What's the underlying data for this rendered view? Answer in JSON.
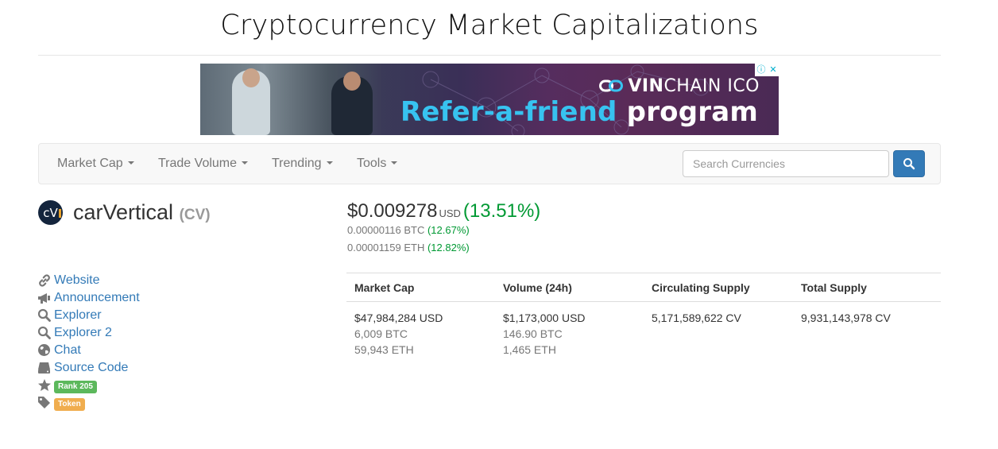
{
  "site": {
    "title": "Cryptocurrency Market Capitalizations"
  },
  "ad": {
    "brand_bold": "VIN",
    "brand_rest": "CHAIN ICO",
    "headline_part1": "Refer-a-friend",
    "headline_part2": "program",
    "choices_icons": [
      "info-icon",
      "close-icon"
    ]
  },
  "navbar": {
    "items": [
      {
        "label": "Market Cap"
      },
      {
        "label": "Trade Volume"
      },
      {
        "label": "Trending"
      },
      {
        "label": "Tools"
      }
    ],
    "search": {
      "placeholder": "Search Currencies",
      "button_icon": "search-icon"
    }
  },
  "coin": {
    "logo_text": "cV",
    "name": "carVertical",
    "symbol": "(CV)",
    "price": {
      "usd": "$0.009278",
      "usd_unit": "USD",
      "usd_change": "(13.51%)",
      "btc": "0.00000116 BTC",
      "btc_change": "(12.67%)",
      "eth": "0.00001159 ETH",
      "eth_change": "(12.82%)"
    }
  },
  "links": [
    {
      "label": "Website",
      "icon": "link-icon"
    },
    {
      "label": "Announcement",
      "icon": "bullhorn-icon"
    },
    {
      "label": "Explorer",
      "icon": "search-icon"
    },
    {
      "label": "Explorer 2",
      "icon": "search-icon"
    },
    {
      "label": "Chat",
      "icon": "globe-icon"
    },
    {
      "label": "Source Code",
      "icon": "hdd-icon"
    }
  ],
  "badges": {
    "rank": {
      "label": "Rank 205",
      "icon": "star-icon",
      "color": "#5cb85c"
    },
    "type": {
      "label": "Token",
      "icon": "tag-icon",
      "color": "#f0ad4e"
    }
  },
  "stats": {
    "headers": [
      "Market Cap",
      "Volume (24h)",
      "Circulating Supply",
      "Total Supply"
    ],
    "market_cap": [
      "$47,984,284 USD",
      "6,009 BTC",
      "59,943 ETH"
    ],
    "volume": [
      "$1,173,000 USD",
      "146.90 BTC",
      "1,465 ETH"
    ],
    "circulating_supply": "5,171,589,622 CV",
    "total_supply": "9,931,143,978 CV"
  },
  "colors": {
    "link": "#337ab7",
    "positive": "#009933",
    "primary_button": "#337ab7"
  }
}
